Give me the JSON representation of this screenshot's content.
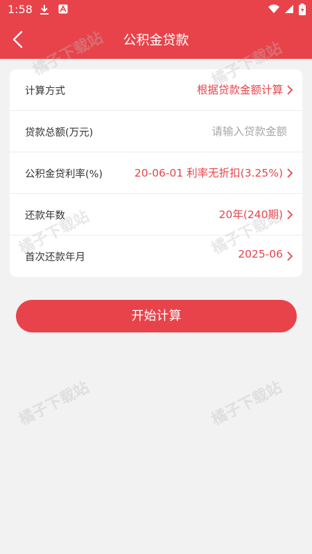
{
  "status_bar": {
    "time": "1:58"
  },
  "header": {
    "title": "公积金贷款",
    "back_icon": "chevron-left-icon"
  },
  "form": {
    "rows": [
      {
        "label": "计算方式",
        "value": "根据贷款金额计算"
      },
      {
        "label": "贷款总额(万元)",
        "placeholder": "请输入贷款金额"
      },
      {
        "label": "公积金贷利率(%)",
        "value": "20-06-01 利率无折扣(3.25%)"
      },
      {
        "label": "还款年数",
        "value": "20年(240期)"
      },
      {
        "label": "首次还款年月",
        "value": "2025-06"
      }
    ]
  },
  "actions": {
    "start_label": "开始计算"
  },
  "watermark": "橘子下载站",
  "colors": {
    "accent": "#e8434a",
    "background": "#f2f2f2",
    "placeholder": "#a8a8a8"
  }
}
